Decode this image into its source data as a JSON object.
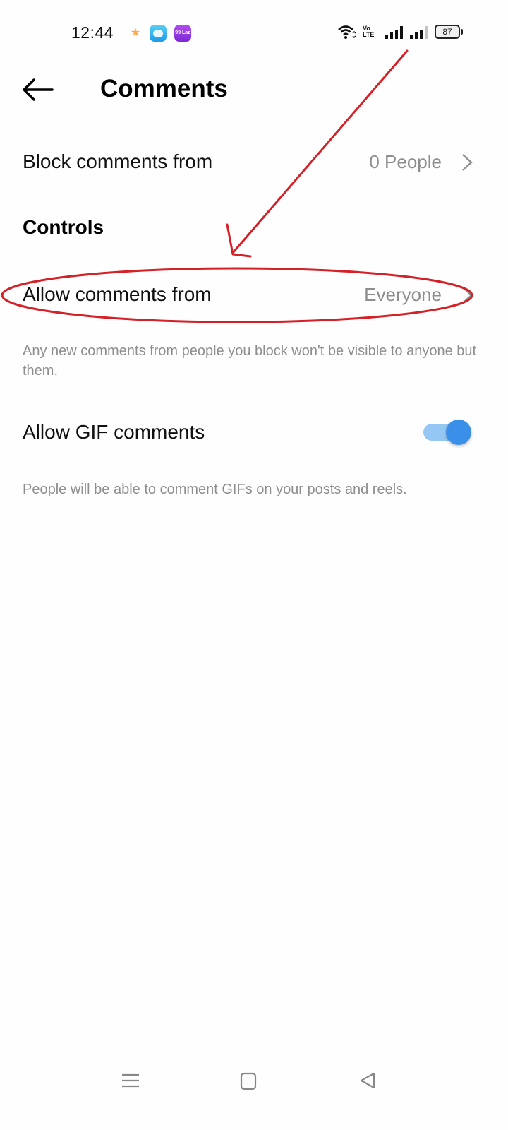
{
  "status_bar": {
    "time": "12:44",
    "app_icons": [
      "star-app-icon",
      "bilibili-app-icon",
      "lazada-app-icon"
    ],
    "lazada_label": "99 Laz",
    "volte_line1": "Vo",
    "volte_line2": "LTE",
    "battery_level": "87"
  },
  "header": {
    "back_icon": "arrow-left-icon",
    "title": "Comments"
  },
  "block_row": {
    "label": "Block comments from",
    "value": "0 People"
  },
  "controls": {
    "heading": "Controls",
    "allow_row": {
      "label": "Allow comments from",
      "value": "Everyone"
    },
    "allow_helper": "Any new comments from people you block won't be visible to anyone but them.",
    "gif_row": {
      "label": "Allow GIF comments",
      "enabled": true
    },
    "gif_helper": "People will be able to comment GIFs on your posts and reels."
  },
  "nav_bar": {
    "items": [
      "menu-icon",
      "home-icon",
      "back-triangle-icon"
    ]
  },
  "colors": {
    "accent": "#3a8fe8",
    "annotation": "#d42027",
    "secondary_text": "#8e8e8e"
  }
}
